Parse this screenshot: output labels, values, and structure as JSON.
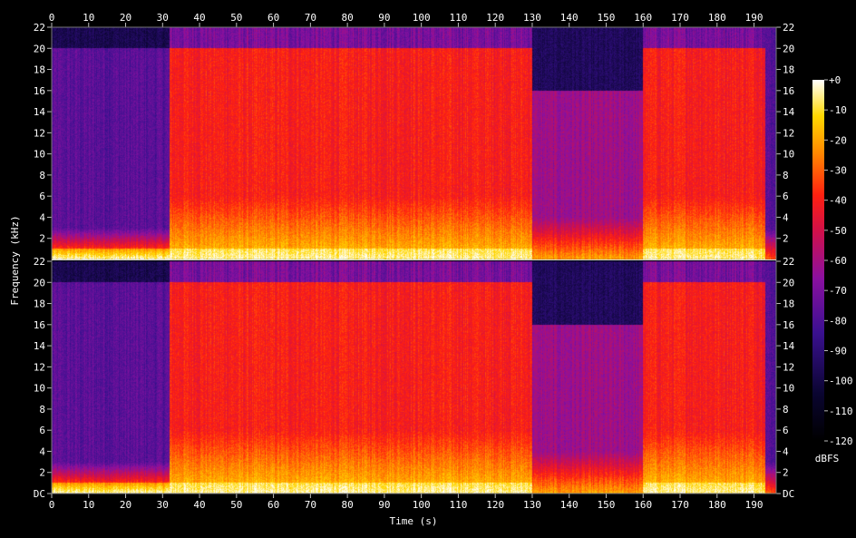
{
  "chart_data": {
    "type": "heatmap",
    "xlabel": "Time (s)",
    "ylabel": "Frequency (kHz)",
    "colorbar_label": "dBFS",
    "xlim": [
      0,
      196
    ],
    "ylim": [
      0,
      22
    ],
    "x_ticks": [
      0,
      10,
      20,
      30,
      40,
      50,
      60,
      70,
      80,
      90,
      100,
      110,
      120,
      130,
      140,
      150,
      160,
      170,
      180,
      190
    ],
    "y_ticks": [
      {
        "v": 0,
        "label": "DC"
      },
      {
        "v": 2,
        "label": "2"
      },
      {
        "v": 4,
        "label": "4"
      },
      {
        "v": 6,
        "label": "6"
      },
      {
        "v": 8,
        "label": "8"
      },
      {
        "v": 10,
        "label": "10"
      },
      {
        "v": 12,
        "label": "12"
      },
      {
        "v": 14,
        "label": "14"
      },
      {
        "v": 16,
        "label": "16"
      },
      {
        "v": 18,
        "label": "18"
      },
      {
        "v": 20,
        "label": "20"
      },
      {
        "v": 22,
        "label": "22"
      }
    ],
    "color_ticks": [
      "+0",
      "-10",
      "-20",
      "-30",
      "-40",
      "-50",
      "-60",
      "-70",
      "-80",
      "-90",
      "-100",
      "-110",
      "-120"
    ],
    "color_range_db": [
      -120,
      0
    ],
    "channels": 2,
    "segments": [
      {
        "t0": 0,
        "t1": 32,
        "kind": "quiet",
        "cutoff_khz": 20
      },
      {
        "t0": 32,
        "t1": 64,
        "kind": "loud",
        "cutoff_khz": 20
      },
      {
        "t0": 64,
        "t1": 96,
        "kind": "loud",
        "cutoff_khz": 20
      },
      {
        "t0": 96,
        "t1": 130,
        "kind": "loud",
        "cutoff_khz": 20
      },
      {
        "t0": 130,
        "t1": 160,
        "kind": "mid",
        "cutoff_khz": 16
      },
      {
        "t0": 160,
        "t1": 193,
        "kind": "loud",
        "cutoff_khz": 20
      },
      {
        "t0": 193,
        "t1": 196,
        "kind": "fade",
        "cutoff_khz": 20
      }
    ]
  }
}
